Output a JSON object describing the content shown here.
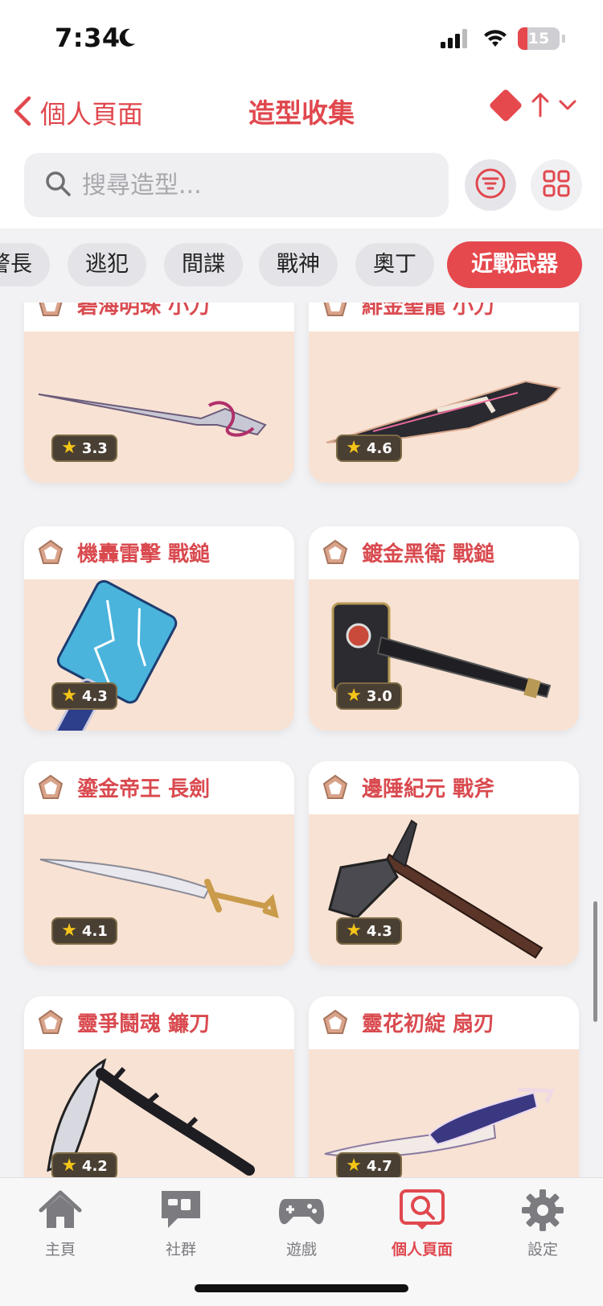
{
  "status_bar": {
    "time": "7:34",
    "battery": "15",
    "icons": [
      "moon-icon",
      "signal-icon",
      "wifi-icon",
      "battery-icon"
    ]
  },
  "nav": {
    "back_label": "個人頁面",
    "title": "造型收集",
    "icons": [
      "chevron-left-icon",
      "diamond-icon",
      "sort-up-icon",
      "chevron-down-icon"
    ]
  },
  "search": {
    "placeholder": "搜尋造型...",
    "value": ""
  },
  "chips": [
    {
      "label": "警長",
      "active": false
    },
    {
      "label": "逃犯",
      "active": false
    },
    {
      "label": "間諜",
      "active": false
    },
    {
      "label": "戰神",
      "active": false
    },
    {
      "label": "奧丁",
      "active": false
    },
    {
      "label": "近戰武器",
      "active": true
    }
  ],
  "cards": [
    {
      "name": "碧海明珠 小刀",
      "rating": "3.3",
      "icon": "knife-icon"
    },
    {
      "name": "緋金聖龍 小刀",
      "rating": "4.6",
      "icon": "knife-icon"
    },
    {
      "name": "機轟雷擊 戰鎚",
      "rating": "4.3",
      "icon": "hammer-icon"
    },
    {
      "name": "鍍金黑衛 戰鎚",
      "rating": "3.0",
      "icon": "hammer-icon"
    },
    {
      "name": "鎏金帝王 長劍",
      "rating": "4.1",
      "icon": "sword-icon"
    },
    {
      "name": "邊陲紀元 戰斧",
      "rating": "4.3",
      "icon": "axe-icon"
    },
    {
      "name": "靈爭鬪魂 鐮刀",
      "rating": "4.2",
      "icon": "scythe-icon"
    },
    {
      "name": "靈花初綻 扇刃",
      "rating": "4.7",
      "icon": "fan-blade-icon"
    }
  ],
  "tabs": [
    {
      "label": "主頁",
      "icon": "home-icon",
      "active": false
    },
    {
      "label": "社群",
      "icon": "chat-icon",
      "active": false
    },
    {
      "label": "遊戲",
      "icon": "gamepad-icon",
      "active": false
    },
    {
      "label": "個人頁面",
      "icon": "profile-search-icon",
      "active": true
    },
    {
      "label": "設定",
      "icon": "gear-icon",
      "active": false
    }
  ],
  "colors": {
    "accent": "#e5484d",
    "card_bg": "#f8e2d4",
    "rating_bg": "#4a3f33",
    "star": "#f5c518"
  }
}
